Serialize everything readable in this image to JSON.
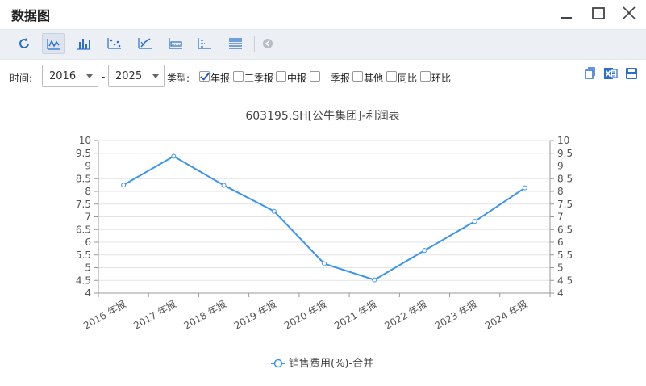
{
  "window": {
    "title": "数据图"
  },
  "toolbar": {
    "buttons": [
      {
        "name": "refresh-icon"
      },
      {
        "name": "line-chart-icon",
        "active": true
      },
      {
        "name": "bar-chart-icon"
      },
      {
        "name": "scatter-chart-icon"
      },
      {
        "name": "trend-chart-icon"
      },
      {
        "name": "area-chart-icon"
      },
      {
        "name": "dot-chart-icon"
      },
      {
        "name": "table-icon"
      },
      {
        "name": "collapse-icon"
      }
    ]
  },
  "filters": {
    "time_label": "时间:",
    "start_year": "2016",
    "dash": "-",
    "end_year": "2025",
    "type_label": "类型:",
    "types": [
      {
        "label": "年报",
        "checked": true
      },
      {
        "label": "三季报",
        "checked": false
      },
      {
        "label": "中报",
        "checked": false
      },
      {
        "label": "一季报",
        "checked": false
      },
      {
        "label": "其他",
        "checked": false
      },
      {
        "label": "同比",
        "checked": false
      },
      {
        "label": "环比",
        "checked": false
      }
    ]
  },
  "chart_data": {
    "type": "line",
    "title": "603195.SH[公牛集团]-利润表",
    "categories": [
      "2016 年报",
      "2017 年报",
      "2018 年报",
      "2019 年报",
      "2020 年报",
      "2021 年报",
      "2022 年报",
      "2023 年报",
      "2024 年报"
    ],
    "series": [
      {
        "name": "销售费用(%)-合并",
        "color": "#3b95f0",
        "values": [
          8.25,
          9.38,
          8.24,
          7.22,
          5.16,
          4.52,
          5.68,
          6.82,
          8.14
        ]
      }
    ],
    "ylim": [
      4,
      10
    ],
    "yticks": [
      "4",
      "4.5",
      "5",
      "5.5",
      "6",
      "6.5",
      "7",
      "7.5",
      "8",
      "8.5",
      "9",
      "9.5",
      "10"
    ],
    "dual_y_axis": true,
    "grid": true,
    "legend": "bottom"
  }
}
